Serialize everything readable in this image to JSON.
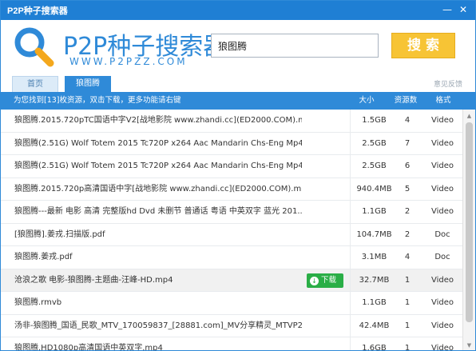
{
  "window": {
    "title": "P2P种子搜索器",
    "min_glyph": "—",
    "close_glyph": "✕"
  },
  "header": {
    "logo_text": "P2P种子搜索器",
    "logo_sub": "WWW.P2PZZ.COM",
    "logo_icon": "magnifier-icon",
    "search_value": "狼图腾",
    "search_button": "搜索",
    "brand_color": "#2f8ad8",
    "button_color": "#f7c435"
  },
  "tabs": [
    {
      "label": "首页"
    },
    {
      "label": "狼图腾"
    }
  ],
  "feedback": "意见反馈",
  "infobar": {
    "message": "为您找到[13]枚资源，双击下载，更多功能请右键",
    "col_size": "大小",
    "col_sources": "资源数",
    "col_format": "格式"
  },
  "download_button": "下载",
  "rows": [
    {
      "name": "狼图腾.2015.720pTC国语中字V2[战地影院 www.zhandi.cc](ED2000.COM).mp4",
      "size": "1.5GB",
      "sources": "4",
      "format": "Video"
    },
    {
      "name": "狼图腾(2.51G) Wolf Totem 2015 Tc720P x264 Aac Mandarin Chs-Eng Mp4...",
      "size": "2.5GB",
      "sources": "7",
      "format": "Video"
    },
    {
      "name": "狼图腾(2.51G) Wolf Totem 2015 Tc720P x264 Aac Mandarin Chs-Eng Mp4...",
      "size": "2.5GB",
      "sources": "6",
      "format": "Video"
    },
    {
      "name": "狼图腾.2015.720p高清国语中字[战地影院 www.zhandi.cc](ED2000.COM).mp4",
      "size": "940.4MB",
      "sources": "5",
      "format": "Video"
    },
    {
      "name": "狼图腾---最新 电影 高清 完整版hd Dvd 未删节 普通话 粤语 中英双字 蓝光 201...",
      "size": "1.1GB",
      "sources": "2",
      "format": "Video"
    },
    {
      "name": "[狼图腾].姜戎.扫描版.pdf",
      "size": "104.7MB",
      "sources": "2",
      "format": "Doc"
    },
    {
      "name": "狼图腾.姜戎.pdf",
      "size": "3.1MB",
      "sources": "4",
      "format": "Doc"
    },
    {
      "name": "沧浪之歌 电影-狼图腾-主题曲-汪峰-HD.mp4",
      "size": "32.7MB",
      "sources": "1",
      "format": "Video",
      "selected": true
    },
    {
      "name": "狼图腾.rmvb",
      "size": "1.1GB",
      "sources": "1",
      "format": "Video"
    },
    {
      "name": "汤非-狼图腾_国语_民歌_MTV_170059837_[28881.com]_MV分享精灵_MTVP2...",
      "size": "42.4MB",
      "sources": "1",
      "format": "Video"
    },
    {
      "name": "狼图腾.HD1080p高清国语中英双字.mp4",
      "size": "1.6GB",
      "sources": "1",
      "format": "Video"
    }
  ]
}
